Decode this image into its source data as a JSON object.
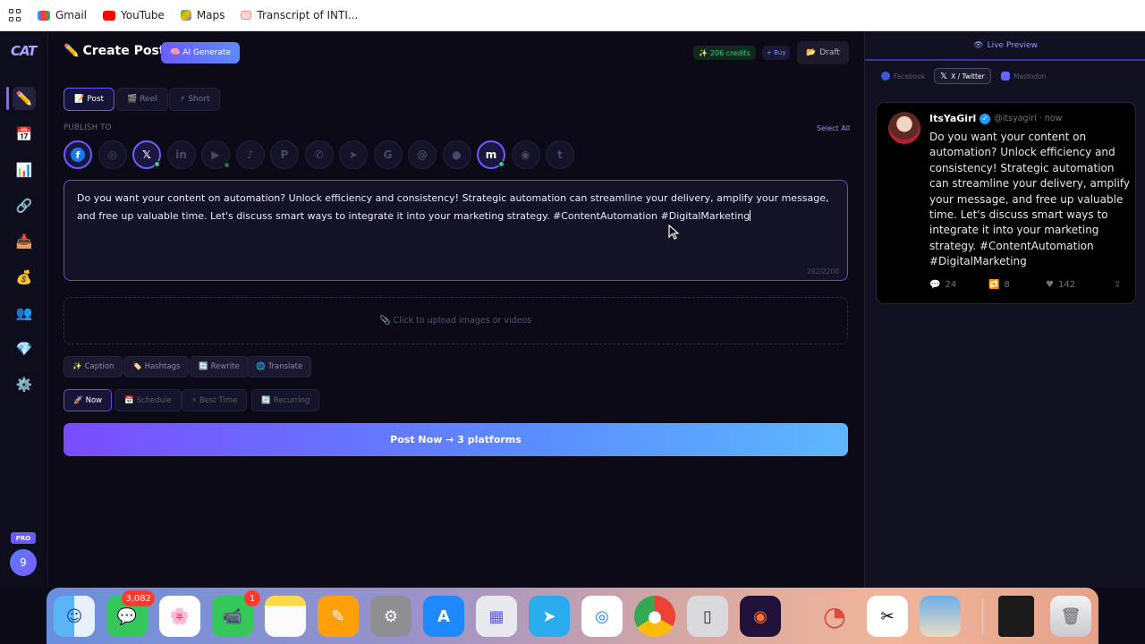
{
  "bookmarks": [
    {
      "label": "Gmail",
      "icon": "gmail-icon",
      "color": "#ea4335"
    },
    {
      "label": "YouTube",
      "icon": "youtube-icon",
      "color": "#ff0000"
    },
    {
      "label": "Maps",
      "icon": "maps-icon",
      "color": "#34a853"
    },
    {
      "label": "Transcript of INTI...",
      "icon": "doc-icon",
      "color": "#f28b82"
    }
  ],
  "app": {
    "logo": "CAT",
    "rail_icons": [
      "pencil-icon",
      "calendar-icon",
      "chart-icon",
      "link-icon",
      "inbox-icon",
      "money-bag-icon",
      "users-icon",
      "gem-icon",
      "gear-icon"
    ],
    "pro_badge": "PRO",
    "avatar_initial": "9"
  },
  "header": {
    "title": "Create Post",
    "ai_button": "AI Generate",
    "credits": "206 credits",
    "buy": "+ Buy",
    "draft": "Draft"
  },
  "post_types": [
    "Post",
    "Reel",
    "Short"
  ],
  "publish": {
    "label": "PUBLISH TO",
    "select_all": "Select All",
    "platforms": [
      {
        "name": "facebook",
        "selected": true,
        "glyph": "f",
        "color": "#1877f2"
      },
      {
        "name": "instagram",
        "selected": false,
        "glyph": "◎"
      },
      {
        "name": "x-twitter",
        "selected": true,
        "glyph": "𝕏",
        "status": "connected"
      },
      {
        "name": "linkedin",
        "selected": false,
        "glyph": "in"
      },
      {
        "name": "youtube",
        "selected": false,
        "glyph": "▶",
        "status": "dim"
      },
      {
        "name": "tiktok",
        "selected": false,
        "glyph": "♪"
      },
      {
        "name": "pinterest",
        "selected": false,
        "glyph": "P"
      },
      {
        "name": "whatsapp",
        "selected": false,
        "glyph": "✆"
      },
      {
        "name": "telegram",
        "selected": false,
        "glyph": "➤"
      },
      {
        "name": "google",
        "selected": false,
        "glyph": "G"
      },
      {
        "name": "threads",
        "selected": false,
        "glyph": "@"
      },
      {
        "name": "reddit",
        "selected": false,
        "glyph": "●"
      },
      {
        "name": "mastodon",
        "selected": true,
        "glyph": "m",
        "status": "connected"
      },
      {
        "name": "discord",
        "selected": false,
        "glyph": "◉"
      },
      {
        "name": "tumblr",
        "selected": false,
        "glyph": "t"
      }
    ]
  },
  "editor": {
    "text": "Do you want your content on automation? Unlock efficiency and consistency! Strategic automation can streamline your delivery, amplify your message, and free up valuable time. Let's discuss smart ways to integrate it into your marketing strategy. #ContentAutomation #DigitalMarketing",
    "counter": "282/2200"
  },
  "upload": {
    "label": "Click to upload images or videos"
  },
  "tools": [
    "Caption",
    "Hashtags",
    "Rewrite",
    "Translate"
  ],
  "schedule": [
    "Now",
    "Schedule",
    "Best Time",
    "Recurring"
  ],
  "post_button": "Post Now → 3 platforms",
  "preview": {
    "title": "Live Preview",
    "tabs": [
      "Facebook",
      "X / Twitter",
      "Mastodon"
    ],
    "tweet": {
      "name": "ItsYaGirl",
      "handle": "@itsyagirl · now",
      "text": "Do you want your content on automation? Unlock efficiency and consistency! Strategic automation can streamline your delivery, amplify your message, and free up valuable time. Let's discuss smart ways to integrate it into your marketing strategy. #ContentAutomation #DigitalMarketing",
      "replies": "24",
      "retweets": "8",
      "likes": "142"
    }
  },
  "dock": {
    "messages_badge": "3,082",
    "facetime_badge": "1",
    "apps": [
      "finder-icon",
      "messages-icon",
      "photos-icon",
      "facetime-icon",
      "notes-icon",
      "pages-icon",
      "system-settings-icon",
      "app-store-icon",
      "launchpad-icon",
      "telegram-icon",
      "safari-icon",
      "chrome-icon",
      "iphone-mirroring-icon",
      "firefox-icon",
      "screen-recorder-icon",
      "capcut-icon",
      "preview-icon",
      "downloads-stack-icon",
      "trash-icon"
    ]
  }
}
